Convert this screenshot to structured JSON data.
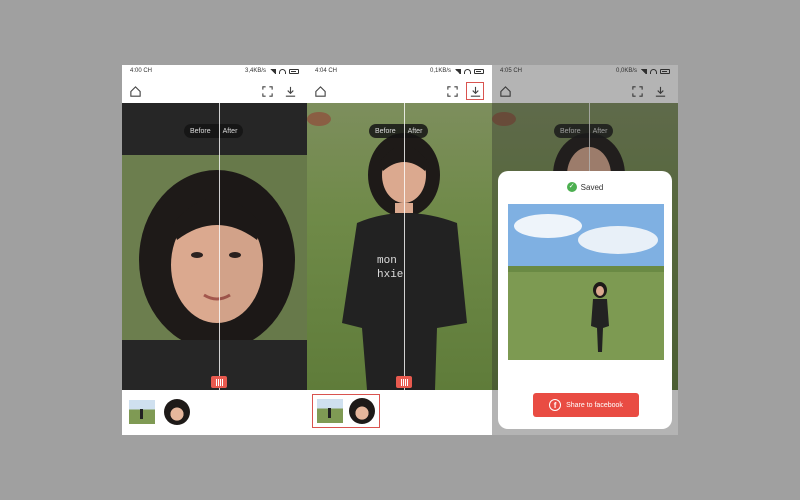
{
  "screens": [
    {
      "status": {
        "time": "4:00 CH",
        "speed": "3,4KB/s"
      },
      "before_label": "Before",
      "after_label": "After"
    },
    {
      "status": {
        "time": "4:04 CH",
        "speed": "0,1KB/s"
      },
      "before_label": "Before",
      "after_label": "After"
    },
    {
      "status": {
        "time": "4:05 CH",
        "speed": "0,0KB/s"
      },
      "before_label": "Before",
      "after_label": "After"
    }
  ],
  "save_dialog": {
    "saved_label": "Saved",
    "share_label": "Share to facebook",
    "share_icon": "f"
  },
  "icons": {
    "home": "home-icon",
    "compare": "compare-icon",
    "download": "download-icon"
  },
  "colors": {
    "accent": "#e94c43",
    "success": "#4caf50",
    "highlight_box": "#d9534f"
  }
}
